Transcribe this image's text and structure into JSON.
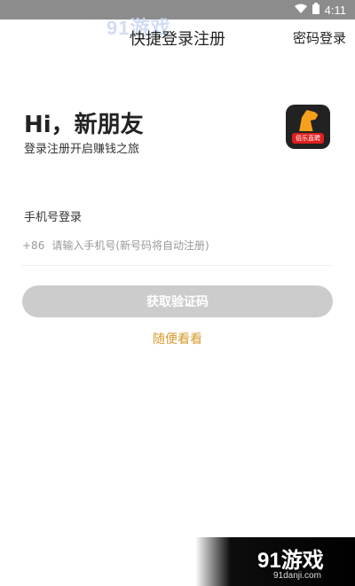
{
  "status_bar": {
    "time": "4:11",
    "wifi_icon": "wifi-icon",
    "battery_icon": "battery-icon"
  },
  "watermark_top": "91游戏",
  "header": {
    "title": "快捷登录注册",
    "right_link": "密码登录"
  },
  "hero": {
    "greeting": "Hi，新朋友",
    "subtitle": "登录注册开启赚钱之旅",
    "logo_text": "佰乐直聘"
  },
  "phone": {
    "label": "手机号登录",
    "country_code": "+86",
    "placeholder": "请输入手机号(新号码将自动注册)",
    "value": ""
  },
  "actions": {
    "get_code_label": "获取验证码",
    "browse_label": "随便看看"
  },
  "watermark_bottom": {
    "brand": "91游戏",
    "url": "91danji.com"
  },
  "colors": {
    "accent": "#d69a2b",
    "button_disabled": "#cccccc",
    "status_bar": "#8c8c8c"
  }
}
